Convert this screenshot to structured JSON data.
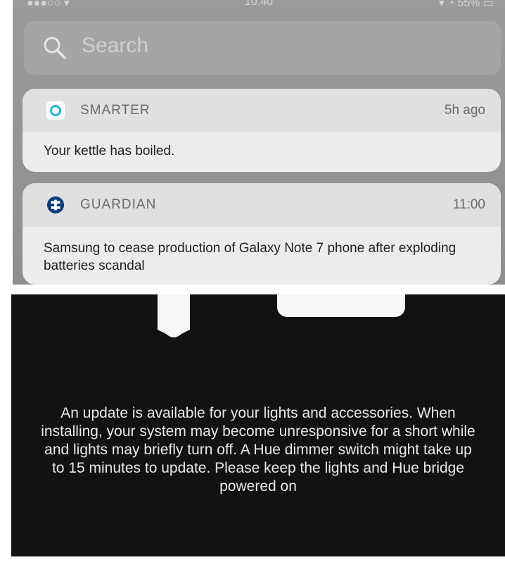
{
  "search": {
    "placeholder": "Search"
  },
  "notifications": [
    {
      "app": "SMARTER",
      "time": "5h ago",
      "message": "Your kettle has boiled."
    },
    {
      "app": "GUARDIAN",
      "time": "11:00",
      "message": "Samsung to cease production of Galaxy Note 7 phone after exploding batteries scandal"
    }
  ],
  "hue_update": {
    "message": "An update is available for your lights and accessories. When installing, your system may become unresponsive for a short while and lights may briefly turn off. A Hue dimmer switch might take up to 15 minutes to update. Please keep the lights and Hue bridge powered on"
  },
  "colors": {
    "notification_center_bg": "#9b9b9d",
    "card_bg": "#ececee",
    "smarter_accent": "#2bb5d8",
    "guardian_accent": "#0b3b78",
    "hue_bg": "#121212"
  },
  "icons": {
    "search": "search-icon",
    "smarter": "smarter-app-icon",
    "guardian": "guardian-app-icon",
    "hue_dimmer": "dimmer-switch-icon"
  }
}
